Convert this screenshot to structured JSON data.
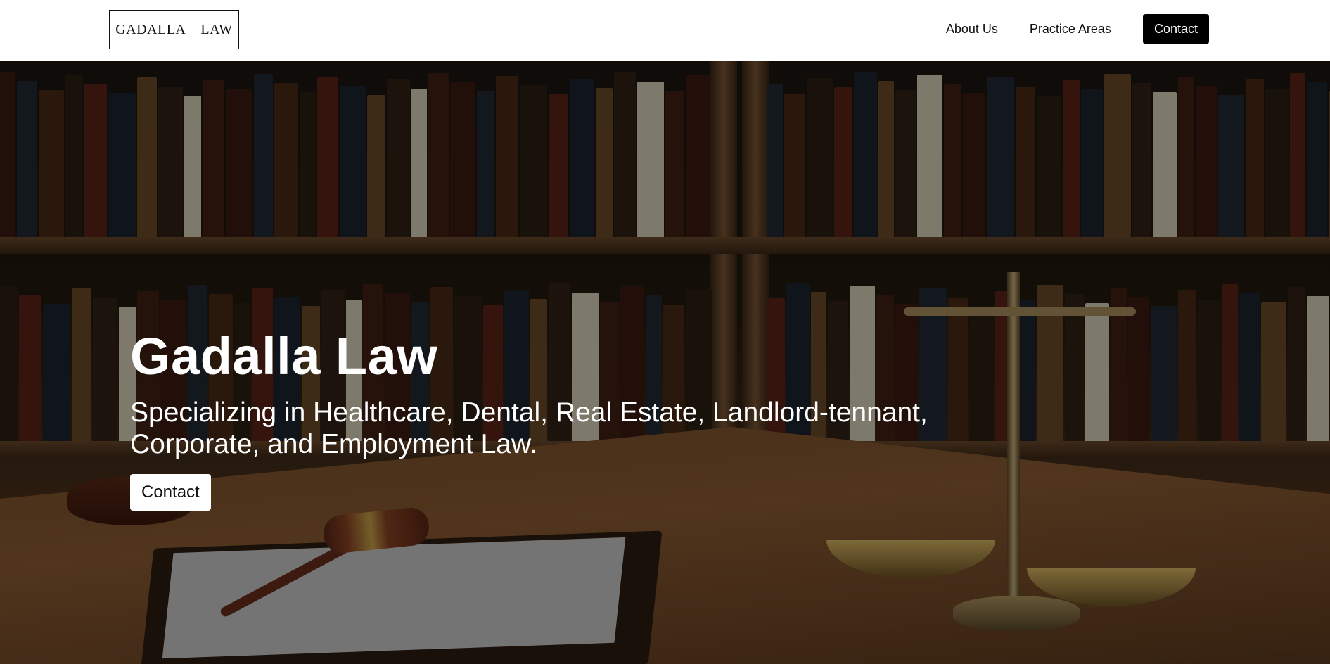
{
  "header": {
    "logo_left": "GADALLA",
    "logo_right": "LAW",
    "nav": {
      "about": "About Us",
      "practice": "Practice Areas",
      "contact": "Contact"
    }
  },
  "hero": {
    "title": "Gadalla Law",
    "subtitle": "Specializing in Healthcare, Dental, Real Estate, Landlord-tennant, Corporate, and Employment Law.",
    "contact_button": "Contact"
  },
  "colors": {
    "header_bg": "#ffffff",
    "primary_button": "#000000",
    "hero_text": "#ffffff"
  }
}
